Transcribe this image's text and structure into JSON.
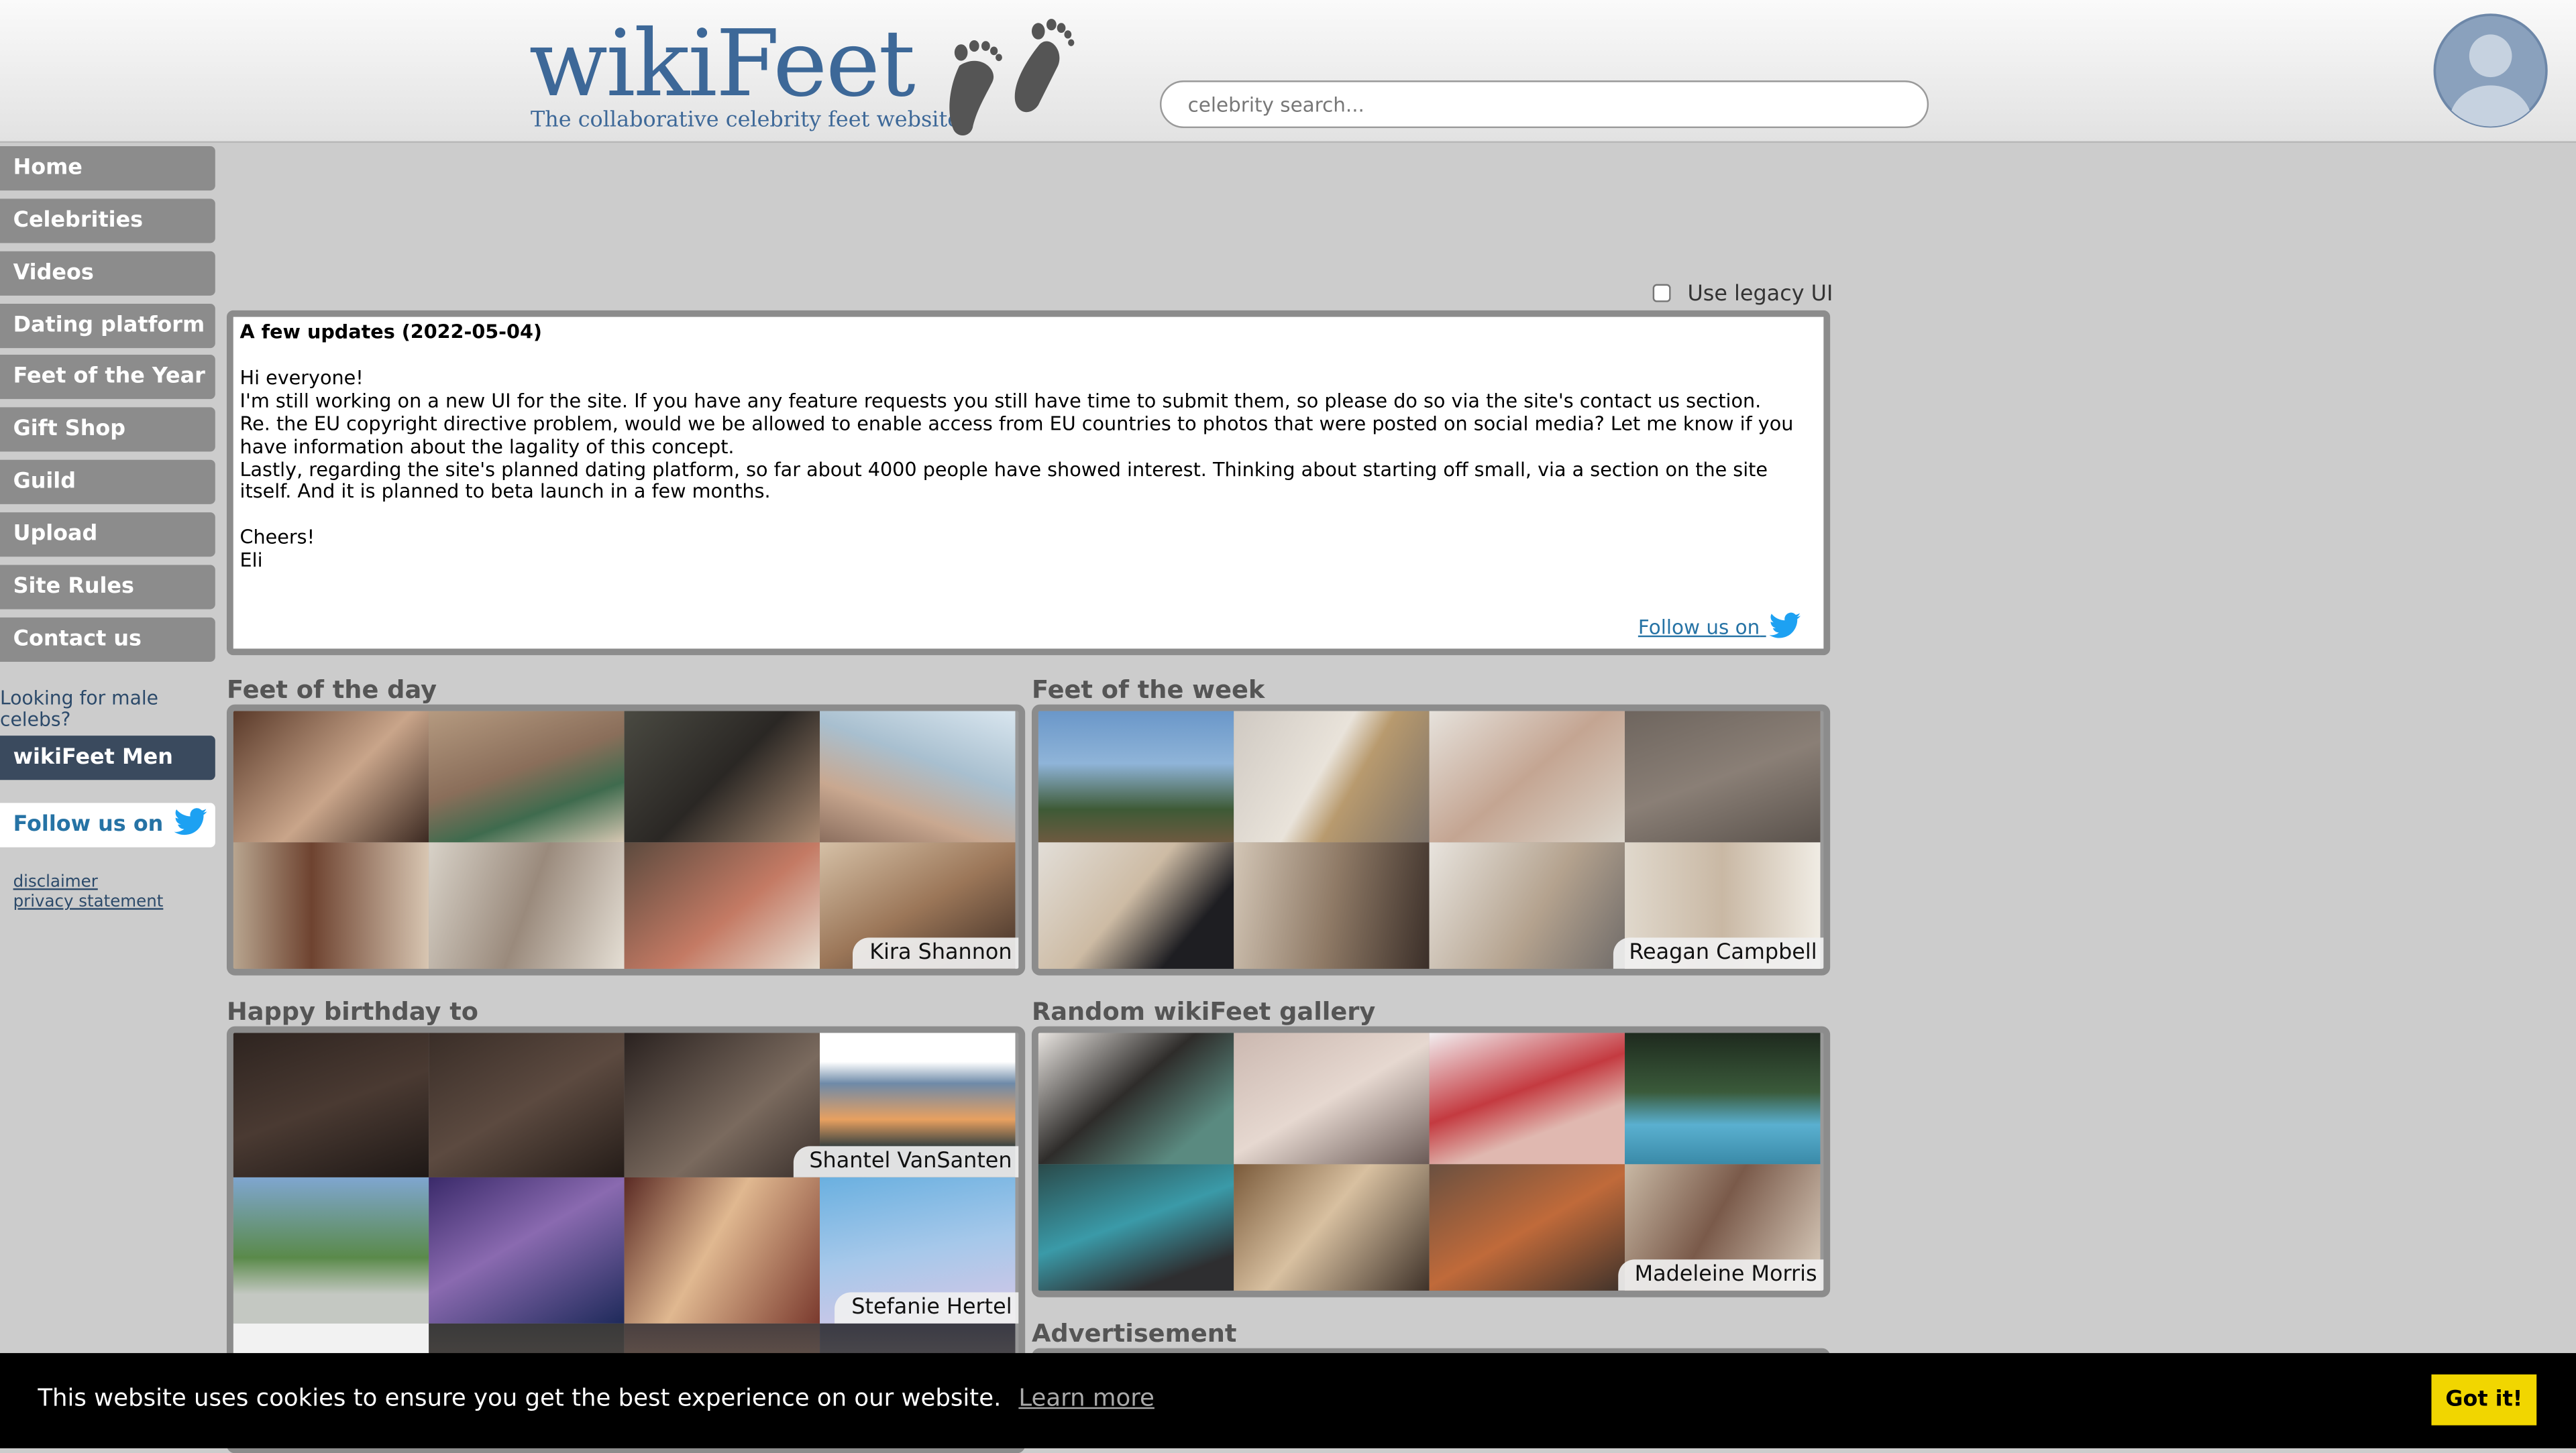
{
  "header": {
    "logo_title": "wikiFeet",
    "logo_tagline": "The collaborative celebrity feet website",
    "search_placeholder": "celebrity search...",
    "search_value": ""
  },
  "sidebar": {
    "items": [
      {
        "label": "Home"
      },
      {
        "label": "Celebrities"
      },
      {
        "label": "Videos"
      },
      {
        "label": "Dating platform"
      },
      {
        "label": "Feet of the Year"
      },
      {
        "label": "Gift Shop"
      },
      {
        "label": "Guild"
      },
      {
        "label": "Upload"
      },
      {
        "label": "Site Rules"
      },
      {
        "label": "Contact us"
      }
    ],
    "male_hint": "Looking for male celebs?",
    "men_label": "wikiFeet Men",
    "follow_label": "Follow us on",
    "disclaimer": "disclaimer",
    "privacy": "privacy statement"
  },
  "legacy_label": "Use legacy UI",
  "news": {
    "title": "A few updates (2022-05-04)",
    "greeting": "Hi everyone!",
    "p1": "I'm still working on a new UI for the site. If you have any feature requests you still have time to submit them, so please do so via the site's contact us section.",
    "p2": "Re. the EU copyright directive problem, would we be allowed to enable access from EU countries to photos that were posted on social media? Let me know if you have information about the lagality of this concept.",
    "p3": "Lastly, regarding the site's planned dating platform, so far about 4000 people have showed interest. Thinking about starting off small, via a section on the site itself. And it is planned to beta launch in a few months.",
    "signoff": "Cheers!",
    "signature": "Eli",
    "follow": "Follow us on"
  },
  "sections": {
    "fotd_title": "Feet of the day",
    "fotd_caption": "Kira Shannon",
    "fotw_title": "Feet of the week",
    "fotw_caption": "Reagan Campbell",
    "bday_title": "Happy birthday to",
    "bday_caption_1": "Shantel VanSanten",
    "bday_caption_2": "Stefanie Hertel",
    "random_title": "Random wikiFeet gallery",
    "random_caption": "Madeleine Morris",
    "ad_title": "Advertisement"
  },
  "cookie": {
    "text": "This website uses cookies to ensure you get the best experience on our website.",
    "learn": "Learn more",
    "button": "Got it!"
  },
  "colors": {
    "accent": "#3d6898",
    "nav": "#8c8c8c",
    "cookie_button": "#f1d600"
  }
}
